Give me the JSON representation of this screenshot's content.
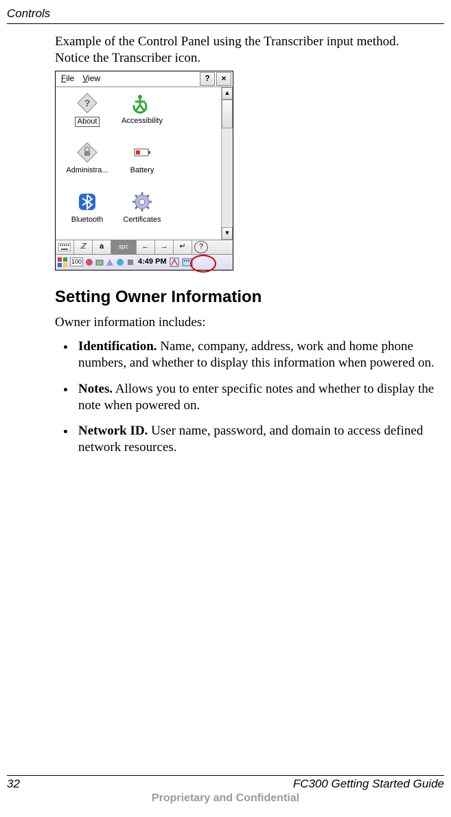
{
  "header": {
    "running_head": "Controls"
  },
  "intro": {
    "line1": "Example of the Control Panel using the Transcriber input method.",
    "line2": "Notice the Transcriber icon."
  },
  "screenshot": {
    "menu": {
      "file": "File",
      "view": "View",
      "help_btn": "?",
      "close_btn": "×"
    },
    "items": [
      {
        "label": "About"
      },
      {
        "label": "Accessibility"
      },
      {
        "label": ""
      },
      {
        "label": "Administra..."
      },
      {
        "label": "Battery"
      },
      {
        "label": ""
      },
      {
        "label": "Bluetooth"
      },
      {
        "label": "Certificates"
      }
    ],
    "toolbar": {
      "kbd": "⌨",
      "script": "𝓏",
      "a": "a",
      "spc": "spc",
      "left": "←",
      "right": "→",
      "enter": "↵",
      "hlp": "?"
    },
    "taskbar": {
      "num": "100",
      "time": "4:49 PM"
    }
  },
  "section": {
    "heading": "Setting Owner Information",
    "lead": "Owner information includes:",
    "bullets": [
      {
        "term": "Identification.",
        "rest": "  Name, company, address, work and home phone numbers, and whether to display this information when powered on."
      },
      {
        "term": "Notes.",
        "rest": "  Allows you to enter specific notes and whether to display the note when powered on."
      },
      {
        "term": "Network ID.",
        "rest": "  User name, password, and domain to access defined network resources."
      }
    ]
  },
  "footer": {
    "page_no": "32",
    "guide": "FC300  Getting Started Guide",
    "confidential": "Proprietary and Confidential"
  }
}
